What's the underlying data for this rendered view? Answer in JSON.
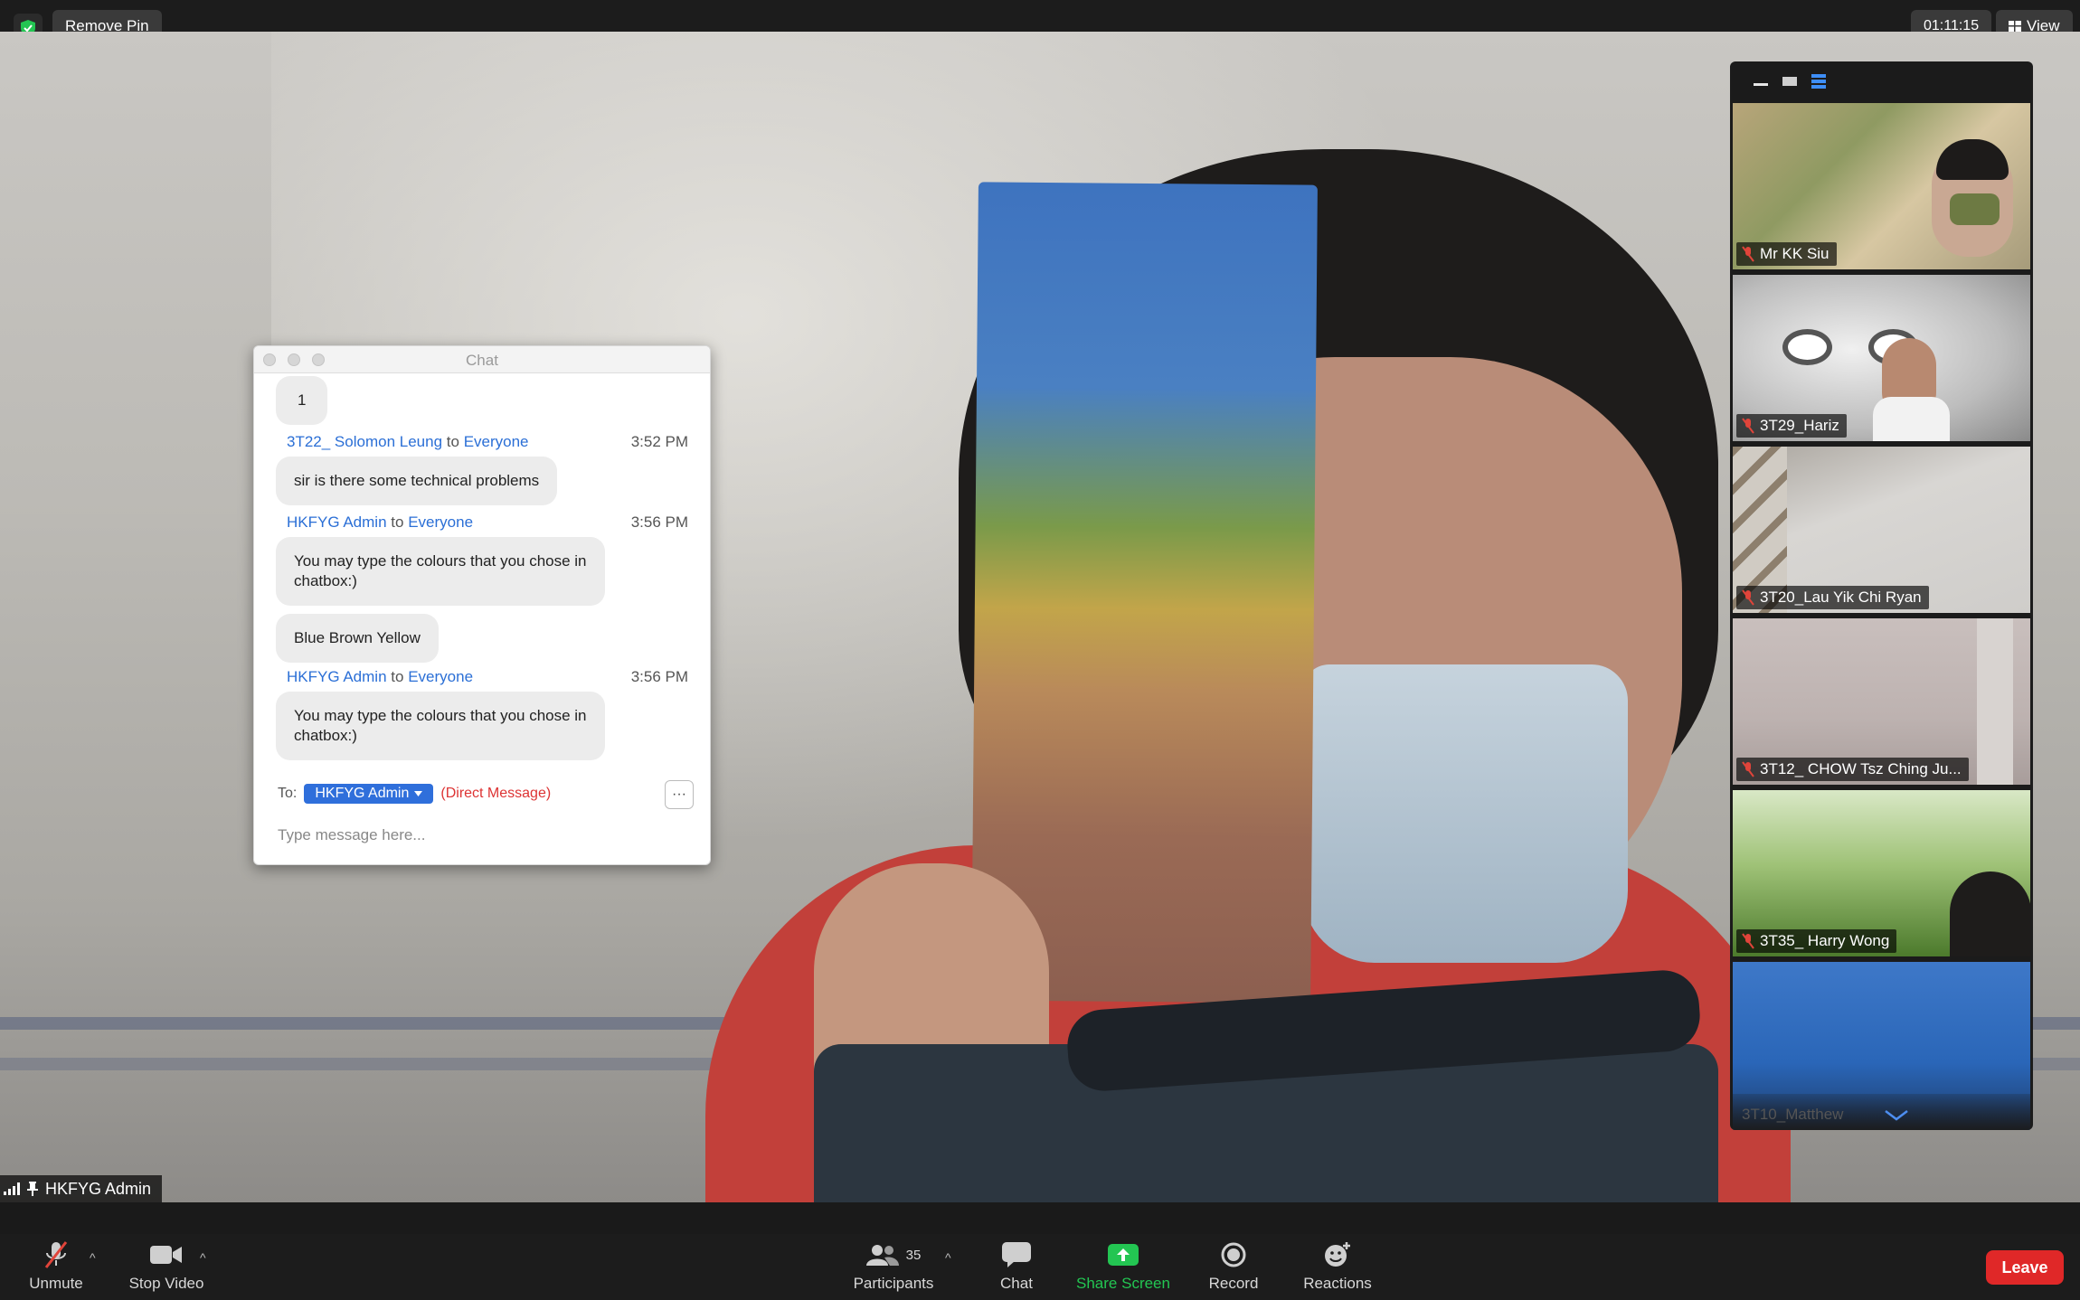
{
  "topbar": {
    "remove_pin": "Remove Pin",
    "timer": "01:11:15",
    "view": "View"
  },
  "chat": {
    "title": "Chat",
    "messages": [
      {
        "bubble": "1"
      },
      {
        "sender": "3T22_ Solomon Leung",
        "to_word": "to",
        "recipient": "Everyone",
        "time": "3:52 PM",
        "bubble": "sir is there some technical problems"
      },
      {
        "sender": "HKFYG Admin",
        "to_word": "to",
        "recipient": "Everyone",
        "time": "3:56 PM",
        "bubble_line1": "You may type the colours that you chose in",
        "bubble_line2": "chatbox:)"
      },
      {
        "bubble": "Blue Brown Yellow"
      },
      {
        "sender": "HKFYG Admin",
        "to_word": "to",
        "recipient": "Everyone",
        "time": "3:56 PM",
        "bubble_line1": "You may type the colours that you chose in",
        "bubble_line2": "chatbox:)"
      }
    ],
    "to_label": "To:",
    "to_recipient": "HKFYG Admin",
    "direct_message": "(Direct Message)",
    "more": "···",
    "input_placeholder": "Type message here..."
  },
  "gallery": {
    "tiles": [
      {
        "name": "Mr KK Siu"
      },
      {
        "name": "3T29_Hariz"
      },
      {
        "name": "3T20_Lau Yik Chi Ryan"
      },
      {
        "name": "3T12_ CHOW Tsz Ching Ju..."
      },
      {
        "name": "3T35_ Harry Wong"
      },
      {
        "name": "3T10_Matthew"
      }
    ]
  },
  "self_badge": {
    "name": "HKFYG Admin"
  },
  "toolbar": {
    "unmute": "Unmute",
    "stop_video": "Stop Video",
    "participants": "Participants",
    "participants_count": "35",
    "chat": "Chat",
    "share_screen": "Share Screen",
    "record": "Record",
    "reactions": "Reactions",
    "leave": "Leave"
  },
  "colors": {
    "accent_blue": "#2f6fdb",
    "share_green": "#23c552",
    "leave_red": "#e02828",
    "mic_off_red": "#e0443a"
  }
}
